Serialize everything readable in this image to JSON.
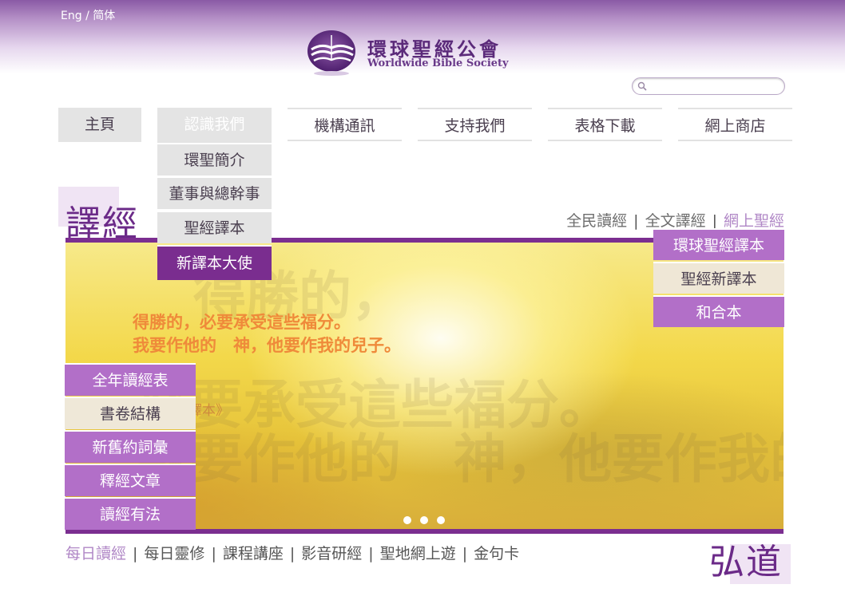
{
  "header": {
    "lang_eng": "Eng",
    "lang_sep": "/",
    "lang_simplified": "简体",
    "logo_cn": "環球聖經公會",
    "logo_en": "Worldwide Bible Society"
  },
  "search": {
    "placeholder": ""
  },
  "nav": {
    "home": "主頁",
    "about": "認識我們",
    "news": "機構通訊",
    "support": "支持我們",
    "forms": "表格下載",
    "shop": "網上商店"
  },
  "about_menu": [
    "環聖簡介",
    "董事與總幹事",
    "聖經譯本",
    "新譯本大使"
  ],
  "section_translation": {
    "title": "譯經",
    "links": [
      "全民讀經",
      "全文譯經",
      "網上聖經"
    ],
    "link_sep": "|"
  },
  "online_bible_menu": [
    "環球聖經譯本",
    "聖經新譯本",
    "和合本"
  ],
  "banner": {
    "line1": "得勝的，必要承受這些福分。",
    "line2": "我要作他的　神，他要作我的兒子。",
    "citation": "《聖經新譯本》"
  },
  "study_menu": [
    "全年讀經表",
    "書卷結構",
    "新舊約詞彙",
    "釋經文章",
    "讀經有法"
  ],
  "section_mission": {
    "title": "弘道",
    "links": [
      "每日讀經",
      "每日靈修",
      "課程講座",
      "影音研經",
      "聖地網上遊",
      "金句卡"
    ],
    "link_sep": "|"
  },
  "colors": {
    "brand_purple": "#7b2e90",
    "menu_lilac": "#b26fc8",
    "banner_text": "#ef8a3a"
  }
}
